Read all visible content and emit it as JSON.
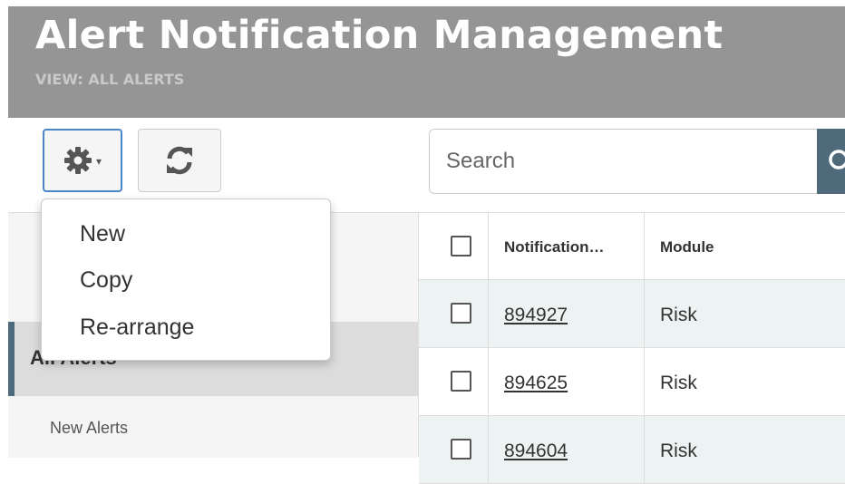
{
  "header": {
    "title": "Alert Notification Management",
    "view_label": "VIEW: ALL ALERTS"
  },
  "toolbar": {
    "settings_icon": "gear-icon",
    "settings_caret": "▾",
    "refresh_icon": "refresh-icon"
  },
  "search": {
    "placeholder": "Search",
    "button_icon": "search-icon"
  },
  "settings_menu": {
    "items": [
      {
        "label": "New"
      },
      {
        "label": "Copy"
      },
      {
        "label": "Re-arrange"
      }
    ]
  },
  "sidebar": {
    "items": [
      {
        "label": "All Alerts",
        "active": true
      },
      {
        "label": "New Alerts",
        "active": false
      }
    ]
  },
  "table": {
    "columns": [
      "Notification…",
      "Module"
    ],
    "rows": [
      {
        "id": "894927",
        "module": "Risk"
      },
      {
        "id": "894625",
        "module": "Risk"
      },
      {
        "id": "894604",
        "module": "Risk"
      }
    ]
  },
  "colors": {
    "header_bg": "#959595",
    "accent": "#4f6b7b",
    "focus_border": "#4a87c8",
    "row_alt": "#edf3f3"
  }
}
